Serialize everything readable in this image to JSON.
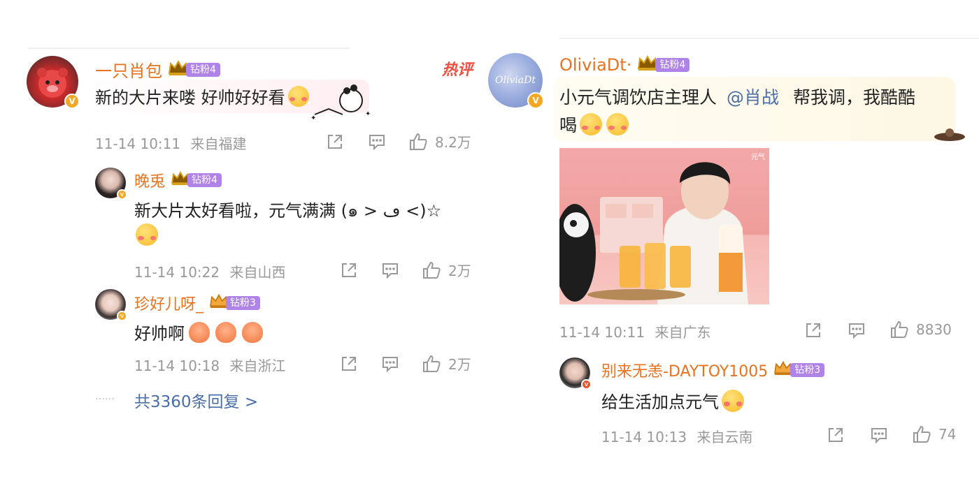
{
  "left": {
    "comment": {
      "username": "一只肖包",
      "fan_badge": "钻粉4",
      "text": "新的大片来喽 好帅好好看",
      "hot_tag": "热评",
      "time": "11-14 10:11",
      "location": "来自福建",
      "likes": "8.2万"
    },
    "replies": [
      {
        "username": "晚兎",
        "fan_badge": "钻粉4",
        "text": "新大片太好看啦，元气满满 (๑ > ڡ <)☆",
        "time": "11-14 10:22",
        "location": "来自山西",
        "likes": "2万"
      },
      {
        "username": "珍好儿呀_",
        "fan_badge": "钻粉3",
        "text": "好帅啊",
        "time": "11-14 10:18",
        "location": "来自浙江",
        "likes": "2万"
      }
    ],
    "more_replies": "共3360条回复 >",
    "more_dots": "……"
  },
  "right": {
    "comment": {
      "username": "OliviaDt·",
      "avatar_text": "OliviaDt",
      "fan_badge": "钻粉4",
      "text_before": "小元气调饮店主理人",
      "mention": "@肖战",
      "text_after": "帮我调，我酷酷",
      "text_line2": "喝",
      "image_brand": "元气",
      "time": "11-14 10:11",
      "location": "来自广东",
      "likes": "8830"
    },
    "reply": {
      "username": "别来无恙-DAYTOY1005",
      "fan_badge": "钻粉3",
      "text": "给生活加点元气",
      "time": "11-14 10:13",
      "location": "来自云南",
      "likes": "74"
    }
  },
  "colors": {
    "username": "#e8731f",
    "fan_badge": "#b083e8",
    "meta": "#999999",
    "link": "#4a6ea8",
    "hot": "#ef4f3f"
  },
  "icons": [
    "share-icon",
    "comment-icon",
    "like-icon",
    "verified-icon",
    "crown-icon",
    "emoji-icon"
  ]
}
